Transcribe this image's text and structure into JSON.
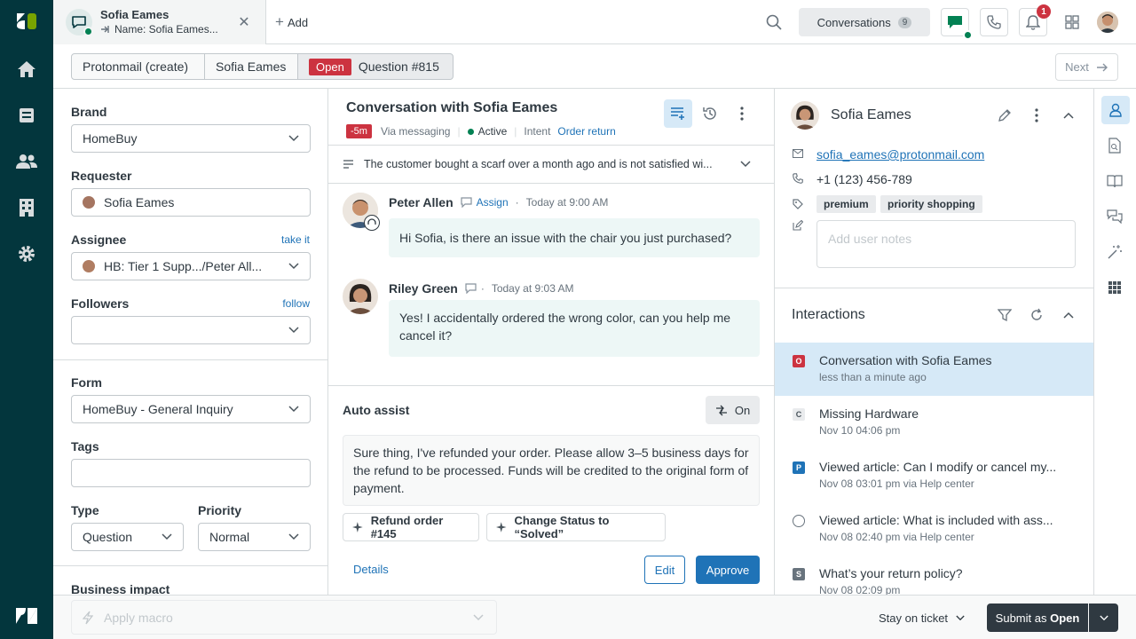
{
  "colors": {
    "rail_bg": "#03363d",
    "accent": "#1f73b7",
    "open_status": "#cc3340",
    "green": "#038153"
  },
  "topbar": {
    "tab_title": "Sofia Eames",
    "tab_subtitle": "Name: Sofia Eames...",
    "add_label": "Add",
    "conversations_label": "Conversations",
    "conversations_count": "9",
    "notification_count": "1"
  },
  "crumbs": {
    "item1": "Protonmail (create)",
    "item2": "Sofia Eames",
    "status": "Open",
    "ticket": "Question #815",
    "next_label": "Next"
  },
  "ticket_fields": {
    "brand_label": "Brand",
    "brand_value": "HomeBuy",
    "requester_label": "Requester",
    "requester_value": "Sofia Eames",
    "assignee_label": "Assignee",
    "assignee_link": "take it",
    "assignee_value": "HB: Tier 1 Supp.../Peter All...",
    "followers_label": "Followers",
    "followers_link": "follow",
    "form_label": "Form",
    "form_value": "HomeBuy - General Inquiry",
    "tags_label": "Tags",
    "type_label": "Type",
    "type_value": "Question",
    "priority_label": "Priority",
    "priority_value": "Normal",
    "business_impact_label": "Business impact"
  },
  "conversation": {
    "title": "Conversation with Sofia Eames",
    "time_badge": "-5m",
    "channel": "Via messaging",
    "state": "Active",
    "intent_label": "Intent",
    "intent_value": "Order return",
    "summary": "The customer bought a scarf over a month ago and is not satisfied wi...",
    "messages": [
      {
        "author": "Peter Allen",
        "action": "Assign",
        "time": "Today at 9:00 AM",
        "text": "Hi Sofia, is there an issue with the chair you just purchased?"
      },
      {
        "author": "Riley Green",
        "time": "Today at 9:03 AM",
        "text": "Yes! I accidentally ordered the wrong color, can you help me cancel it?"
      }
    ]
  },
  "auto_assist": {
    "title": "Auto assist",
    "toggle_label": "On",
    "suggestion": "Sure thing, I've refunded your order. Please allow 3–5 business days for the refund to be processed. Funds will be credited to the original form of payment.",
    "action1": "Refund order #145",
    "action2": "Change Status to “Solved”",
    "details_label": "Details",
    "edit_label": "Edit",
    "approve_label": "Approve"
  },
  "customer": {
    "name": "Sofia Eames",
    "email": "sofia_eames@protonmail.com",
    "phone": "+1 (123) 456-789",
    "tags": [
      "premium",
      "priority shopping"
    ],
    "notes_placeholder": "Add user notes"
  },
  "interactions": {
    "title": "Interactions",
    "items": [
      {
        "badge": "O",
        "badge_color": "#cc3340",
        "title": "Conversation with Sofia Eames",
        "sub": "less than a minute ago"
      },
      {
        "badge": "C",
        "badge_color": "#68737d",
        "title": "Missing Hardware",
        "sub": "Nov 10 04:06 pm"
      },
      {
        "badge": "P",
        "badge_color": "#1f73b7",
        "title": "Viewed article: Can I modify or cancel my...",
        "sub": "Nov 08 03:01 pm via Help center"
      },
      {
        "badge": "",
        "badge_color": "",
        "title": "Viewed article: What is included with ass...",
        "sub": "Nov 08 02:40 pm via Help center"
      },
      {
        "badge": "S",
        "badge_color": "#68737d",
        "title": "What’s your return policy?",
        "sub": "Nov 08 02:09 pm"
      }
    ]
  },
  "bottom": {
    "macro_placeholder": "Apply macro",
    "stay_label": "Stay on ticket",
    "submit_prefix": "Submit as ",
    "submit_status": "Open"
  }
}
